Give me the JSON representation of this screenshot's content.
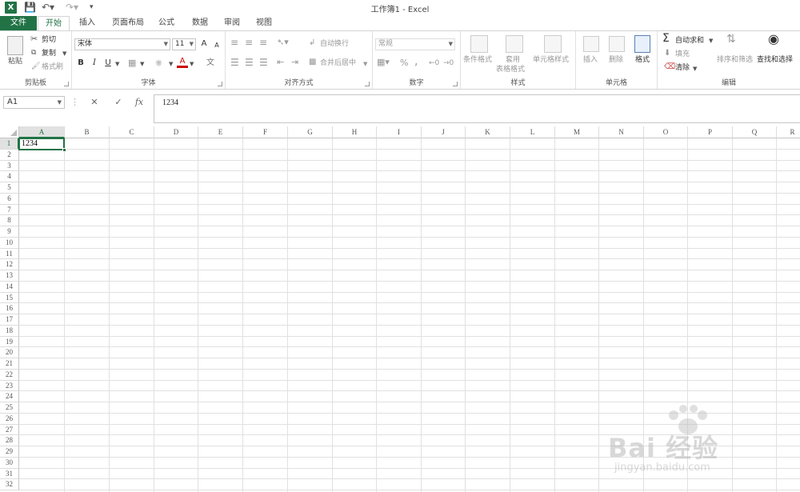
{
  "window": {
    "title": "工作簿1 - Excel",
    "app_badge": "X"
  },
  "qat": {
    "save_icon": "save-icon",
    "undo_icon": "undo-icon",
    "redo_icon": "redo-icon",
    "customize_icon": "customize-icon"
  },
  "tabs": [
    {
      "label": "文件"
    },
    {
      "label": "开始"
    },
    {
      "label": "插入"
    },
    {
      "label": "页面布局"
    },
    {
      "label": "公式"
    },
    {
      "label": "数据"
    },
    {
      "label": "审阅"
    },
    {
      "label": "视图"
    }
  ],
  "ribbon": {
    "clipboard": {
      "label": "剪贴板",
      "paste": "粘贴",
      "cut": "剪切",
      "copy": "复制",
      "format_painter": "格式刷"
    },
    "font": {
      "label": "字体",
      "font_name": "宋体",
      "font_size": "11",
      "bold": "B",
      "italic": "I",
      "underline": "U",
      "grow": "A",
      "shrink": "A",
      "font_color": "A",
      "phonetic": "文"
    },
    "alignment": {
      "label": "对齐方式",
      "wrap": "自动换行",
      "merge": "合并后居中"
    },
    "number": {
      "label": "数字",
      "format": "常规",
      "percent": "%",
      "comma": ","
    },
    "styles": {
      "label": "样式",
      "conditional": "条件格式",
      "table_line1": "套用",
      "table_line2": "表格格式",
      "cell_styles": "单元格样式"
    },
    "cells": {
      "label": "单元格",
      "insert": "插入",
      "delete": "删除",
      "format": "格式"
    },
    "editing": {
      "label": "编辑",
      "autosum": "自动求和",
      "fill": "填充",
      "clear": "清除",
      "sort": "排序和筛选",
      "find": "查找和选择"
    }
  },
  "formula_bar": {
    "name_box": "A1",
    "cancel": "✕",
    "enter": "✓",
    "fx": "fx",
    "content": "1234"
  },
  "sheet": {
    "columns": [
      "A",
      "B",
      "C",
      "D",
      "E",
      "F",
      "G",
      "H",
      "I",
      "J",
      "K",
      "L",
      "M",
      "N",
      "O",
      "P",
      "Q",
      "R"
    ],
    "rows": [
      "1",
      "2",
      "3",
      "4",
      "5",
      "6",
      "7",
      "8",
      "9",
      "10",
      "11",
      "12",
      "13",
      "14",
      "15",
      "16",
      "17",
      "18",
      "19",
      "20",
      "21",
      "22",
      "23",
      "24",
      "25",
      "26",
      "27",
      "28",
      "29",
      "30",
      "31",
      "32"
    ],
    "selected_cell": "A1",
    "cells": {
      "A1": "1234"
    }
  },
  "watermark": {
    "brand": "Bai 经验",
    "url": "jingyan.baidu.com"
  },
  "colors": {
    "accent": "#217346"
  }
}
